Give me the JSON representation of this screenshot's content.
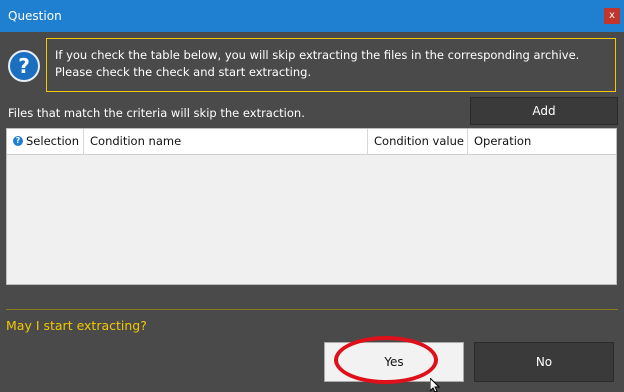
{
  "window": {
    "title": "Question",
    "close_glyph": "x"
  },
  "icons": {
    "info": "question-icon",
    "help": "help-icon",
    "cursor": "arrow-cursor-icon"
  },
  "message": "If you check the table below, you will skip extracting the files in the corresponding archive. Please check the check and start extracting.",
  "criteria_label": "Files that match the criteria will skip the extraction.",
  "add_button": "Add",
  "table": {
    "columns": [
      "Selection",
      "Condition name",
      "Condition value",
      "Operation"
    ],
    "rows": []
  },
  "prompt": "May I start extracting?",
  "buttons": {
    "yes": "Yes",
    "no": "No"
  },
  "colors": {
    "titlebar": "#1f7fd1",
    "accent": "#f2c800",
    "highlight": "#e0101a",
    "background": "#4a4a4a"
  }
}
